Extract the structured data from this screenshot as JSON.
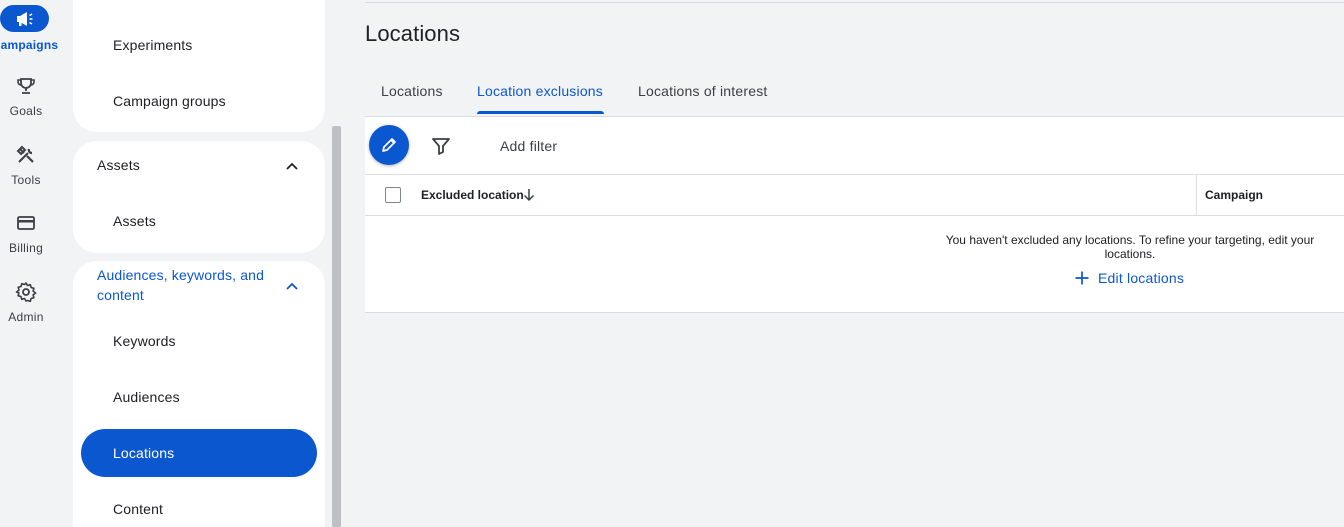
{
  "rail": {
    "items": [
      {
        "label": "Campaigns",
        "icon": "megaphone-icon",
        "active": true
      },
      {
        "label": "Goals",
        "icon": "trophy-icon"
      },
      {
        "label": "Tools",
        "icon": "tools-icon"
      },
      {
        "label": "Billing",
        "icon": "credit-card-icon"
      },
      {
        "label": "Admin",
        "icon": "gear-icon"
      }
    ]
  },
  "nav": {
    "group1": {
      "items": [
        "Experiments",
        "Campaign groups"
      ]
    },
    "group2": {
      "header": "Assets",
      "items": [
        "Assets"
      ]
    },
    "group3": {
      "header": "Audiences, keywords, and content",
      "items": [
        "Keywords",
        "Audiences",
        "Locations",
        "Content"
      ],
      "selected": "Locations"
    }
  },
  "main": {
    "title": "Locations",
    "tabs": [
      {
        "label": "Locations"
      },
      {
        "label": "Location exclusions",
        "active": true
      },
      {
        "label": "Locations of interest"
      }
    ],
    "toolbar": {
      "add_filter": "Add filter"
    },
    "table": {
      "columns": [
        "Excluded location",
        "Campaign"
      ],
      "empty_message": "You haven't excluded any locations. To refine your targeting, edit your locations.",
      "edit_link": "Edit locations"
    }
  },
  "colors": {
    "accent": "#0b57d0",
    "background": "#f1f3f4",
    "surface": "#ffffff"
  }
}
